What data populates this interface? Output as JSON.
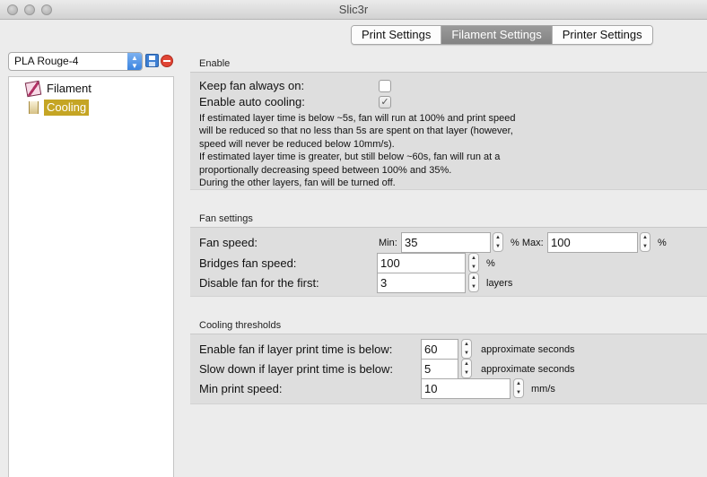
{
  "window": {
    "title": "Slic3r"
  },
  "tabs": [
    {
      "label": "Print Settings",
      "active": false
    },
    {
      "label": "Filament Settings",
      "active": true
    },
    {
      "label": "Printer Settings",
      "active": false
    }
  ],
  "preset": {
    "selected": "PLA Rouge-4"
  },
  "tree": [
    {
      "label": "Filament",
      "icon": "filament-icon",
      "selected": false
    },
    {
      "label": "Cooling",
      "icon": "cooling-icon",
      "selected": true
    }
  ],
  "enable_section": {
    "title": "Enable",
    "keep_fan_label": "Keep fan always on:",
    "keep_fan_checked": false,
    "auto_cooling_label": "Enable auto cooling:",
    "auto_cooling_checked": true,
    "description": [
      "If estimated layer time is below ~5s, fan will run at 100% and print speed",
      "will be reduced so that no less than 5s are spent on that layer (however,",
      "speed will never be reduced below 10mm/s).",
      "If estimated layer time is greater, but still below ~60s, fan will run at a",
      "proportionally decreasing speed between 100% and 35%.",
      "During the other layers, fan will be turned off."
    ]
  },
  "fan_section": {
    "title": "Fan settings",
    "fan_speed_label": "Fan speed:",
    "min_label": "Min:",
    "min_value": "35",
    "pct_max_label": "% Max:",
    "max_value": "100",
    "max_unit": "%",
    "bridges_label": "Bridges fan speed:",
    "bridges_value": "100",
    "bridges_unit": "%",
    "disable_label": "Disable fan for the first:",
    "disable_value": "3",
    "disable_unit": "layers"
  },
  "thresholds_section": {
    "title": "Cooling thresholds",
    "enable_fan_label": "Enable fan if layer print time is below:",
    "enable_fan_value": "60",
    "enable_fan_unit": "approximate seconds",
    "slow_down_label": "Slow down if layer print time is below:",
    "slow_down_value": "5",
    "slow_down_unit": "approximate seconds",
    "min_speed_label": "Min print speed:",
    "min_speed_value": "10",
    "min_speed_unit": "mm/s"
  }
}
